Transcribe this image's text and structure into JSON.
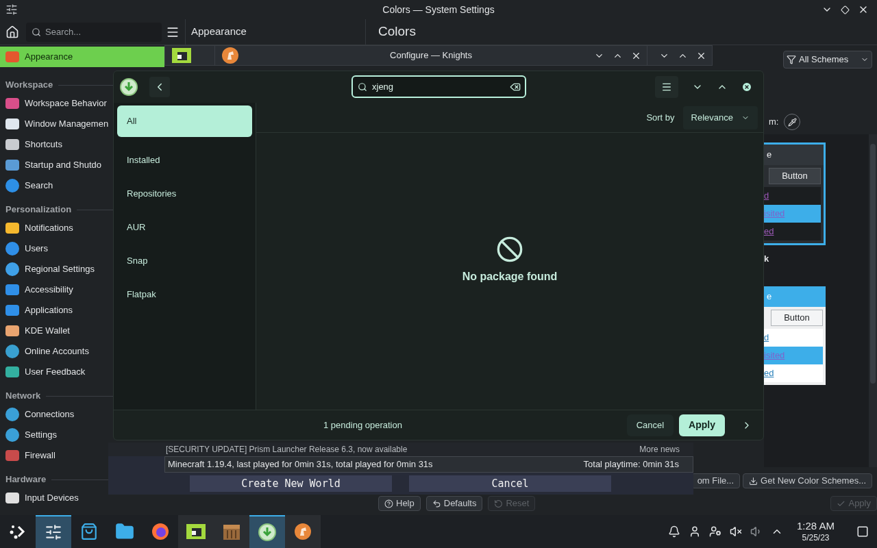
{
  "settings_window": {
    "title": "Colors — System Settings",
    "search": {
      "placeholder": "Search..."
    },
    "breadcrumb": "Appearance",
    "page_title": "Colors",
    "sidebar": [
      {
        "kind": "item",
        "label": "Appearance",
        "selected": true
      },
      {
        "kind": "header",
        "label": "Workspace"
      },
      {
        "kind": "item",
        "label": "Workspace Behavior",
        "selected": false
      },
      {
        "kind": "item",
        "label": "Window Managemen",
        "selected": false
      },
      {
        "kind": "item",
        "label": "Shortcuts",
        "selected": false
      },
      {
        "kind": "item",
        "label": "Startup and Shutdo",
        "selected": false
      },
      {
        "kind": "item",
        "label": "Search",
        "selected": false
      },
      {
        "kind": "header",
        "label": "Personalization"
      },
      {
        "kind": "item",
        "label": "Notifications",
        "selected": false
      },
      {
        "kind": "item",
        "label": "Users",
        "selected": false
      },
      {
        "kind": "item",
        "label": "Regional Settings",
        "selected": false
      },
      {
        "kind": "item",
        "label": "Accessibility",
        "selected": false
      },
      {
        "kind": "item",
        "label": "Applications",
        "selected": false
      },
      {
        "kind": "item",
        "label": "KDE Wallet",
        "selected": false
      },
      {
        "kind": "item",
        "label": "Online Accounts",
        "selected": false
      },
      {
        "kind": "item",
        "label": "User Feedback",
        "selected": false
      },
      {
        "kind": "header",
        "label": "Network"
      },
      {
        "kind": "item",
        "label": "Connections",
        "selected": false
      },
      {
        "kind": "item",
        "label": "Settings",
        "selected": false
      },
      {
        "kind": "item",
        "label": "Firewall",
        "selected": false
      },
      {
        "kind": "header",
        "label": "Hardware"
      },
      {
        "kind": "item",
        "label": "Input Devices",
        "selected": false
      }
    ],
    "filter": "All Schemes",
    "pick_label": "m:",
    "previews": [
      {
        "title": "e",
        "button": "Button",
        "links": [
          "d",
          "isited",
          "ed"
        ],
        "selected": true,
        "kind": "dark"
      },
      {
        "title": "e",
        "button": "Button",
        "links": [
          "d",
          "isited",
          "ed"
        ],
        "selected": false,
        "kind": "light"
      }
    ],
    "preview_caption": "k",
    "actions": [
      {
        "label": "om File...",
        "disabled": false
      },
      {
        "label": "Get New Color Schemes...",
        "disabled": false
      }
    ],
    "footer": [
      {
        "label": "Help",
        "disabled": false
      },
      {
        "label": "Defaults",
        "disabled": false
      },
      {
        "label": "Reset",
        "disabled": true
      },
      {
        "label": "Apply",
        "disabled": true
      }
    ]
  },
  "launcher_window": {
    "title": "Configure — Knights",
    "news": "[SECURITY UPDATE] Prism Launcher Release 6.3, now available",
    "more_news": "More news",
    "status": "Minecraft 1.19.4, last played for 0min 31s, total played for 0min 31s",
    "playtime": "Total playtime: 0min 31s",
    "buttons": [
      "Create New World",
      "Cancel"
    ]
  },
  "discover": {
    "search": {
      "value": "xjeng"
    },
    "nav": [
      {
        "label": "All",
        "selected": true
      },
      {
        "label": "Installed",
        "selected": false
      },
      {
        "label": "Repositories",
        "selected": false
      },
      {
        "label": "AUR",
        "selected": false
      },
      {
        "label": "Snap",
        "selected": false
      },
      {
        "label": "Flatpak",
        "selected": false
      }
    ],
    "sort_label": "Sort by",
    "sort_value": "Relevance",
    "empty_message": "No package found",
    "status": "1 pending operation",
    "buttons": [
      {
        "label": "Cancel",
        "kind": "secondary"
      },
      {
        "label": "Apply",
        "kind": "primary"
      }
    ]
  },
  "taskbar": {
    "tasks": [
      {
        "active": false
      },
      {
        "active": true
      },
      {
        "active": false
      },
      {
        "active": false
      },
      {
        "active": false
      },
      {
        "active": false
      },
      {
        "active": false
      },
      {
        "active": true
      },
      {
        "active": false
      }
    ],
    "time": "1:28 AM",
    "date": "5/25/23"
  }
}
